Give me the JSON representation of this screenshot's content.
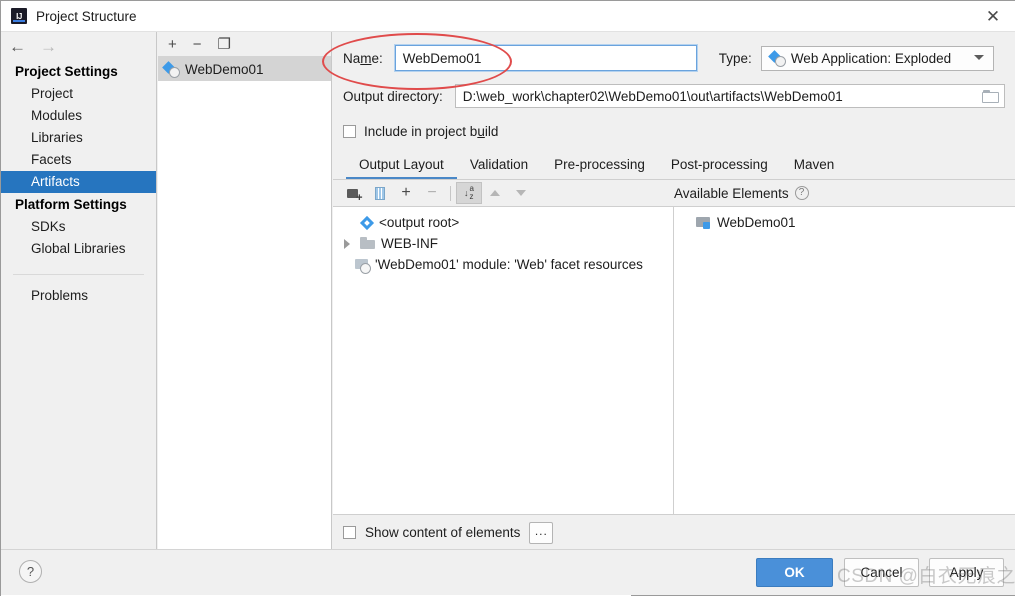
{
  "window": {
    "title": "Project Structure",
    "app_icon": "intellij-idea-icon",
    "close_label": "✕",
    "back_arrow": "←",
    "forward_arrow": "→"
  },
  "sidebar": {
    "project_settings_label": "Project Settings",
    "platform_settings_label": "Platform Settings",
    "project_items": [
      {
        "label": "Project",
        "selected": false
      },
      {
        "label": "Modules",
        "selected": false
      },
      {
        "label": "Libraries",
        "selected": false
      },
      {
        "label": "Facets",
        "selected": false
      },
      {
        "label": "Artifacts",
        "selected": true
      }
    ],
    "platform_items": [
      {
        "label": "SDKs",
        "selected": false
      },
      {
        "label": "Global Libraries",
        "selected": false
      }
    ],
    "problems_label": "Problems"
  },
  "artifact_list": {
    "toolbar": [
      {
        "name": "add-artifact-button",
        "glyph": "+"
      },
      {
        "name": "remove-artifact-button",
        "glyph": "−"
      },
      {
        "name": "copy-artifact-button",
        "glyph": "❐"
      }
    ],
    "items": [
      {
        "label": "WebDemo01",
        "selected": true,
        "icon": "artifact-icon"
      }
    ]
  },
  "form": {
    "name_label": "Name:",
    "name_value": "WebDemo01",
    "name_placeholder": "",
    "type_label": "Type:",
    "type_value": "Web Application: Exploded",
    "type_icon": "artifact-icon",
    "output_directory_label": "Output directory:",
    "output_directory_value": "D:\\web_work\\chapter02\\WebDemo01\\out\\artifacts\\WebDemo01",
    "output_directory_browse_icon": "folder-icon",
    "include_in_build_label": "Include in project build",
    "include_in_build_checked": false
  },
  "tabs": [
    {
      "label": "Output Layout",
      "active": true
    },
    {
      "label": "Validation",
      "active": false
    },
    {
      "label": "Pre-processing",
      "active": false
    },
    {
      "label": "Post-processing",
      "active": false
    },
    {
      "label": "Maven",
      "active": false
    }
  ],
  "layout_toolbar": [
    {
      "name": "add-folder-button",
      "icon": "add-folder-icon",
      "active": false,
      "disabled": false
    },
    {
      "name": "create-archive-button",
      "icon": "jar-archive-icon",
      "active": false,
      "disabled": false
    },
    {
      "name": "add-copy-of-button",
      "icon": "plus-dropdown-icon",
      "glyph": "+",
      "active": false,
      "disabled": false
    },
    {
      "name": "remove-element-button",
      "icon": "minus-icon",
      "glyph": "−",
      "active": false,
      "disabled": true
    },
    {
      "name": "sort-alphabetically-button",
      "icon": "sort-az-icon",
      "active": true,
      "disabled": false
    },
    {
      "name": "move-up-button",
      "icon": "triangle-up-icon",
      "active": false,
      "disabled": true
    },
    {
      "name": "move-down-button",
      "icon": "triangle-down-icon",
      "active": false,
      "disabled": true
    }
  ],
  "output_tree": [
    {
      "label": "<output root>",
      "icon": "output-root-icon",
      "indent": 1,
      "expander": false
    },
    {
      "label": "WEB-INF",
      "icon": "folder-icon",
      "indent": 1,
      "expander": true
    },
    {
      "label": "'WebDemo01' module: 'Web' facet resources",
      "icon": "facet-resources-icon",
      "indent": 2,
      "expander": false
    }
  ],
  "available_elements": {
    "header": "Available Elements",
    "help_glyph": "?",
    "items": [
      {
        "label": "WebDemo01",
        "icon": "module-icon"
      }
    ]
  },
  "bottom_options": {
    "show_content_label": "Show content of elements",
    "show_content_checked": false,
    "more_button_label": "..."
  },
  "footer": {
    "help_glyph": "?",
    "ok_label": "OK",
    "cancel_label": "Cancel",
    "apply_label": "Apply"
  },
  "annotations": {
    "ellipse_color": "#e04b4b",
    "watermark_text": "CSDN @白衣无痕之尘"
  }
}
